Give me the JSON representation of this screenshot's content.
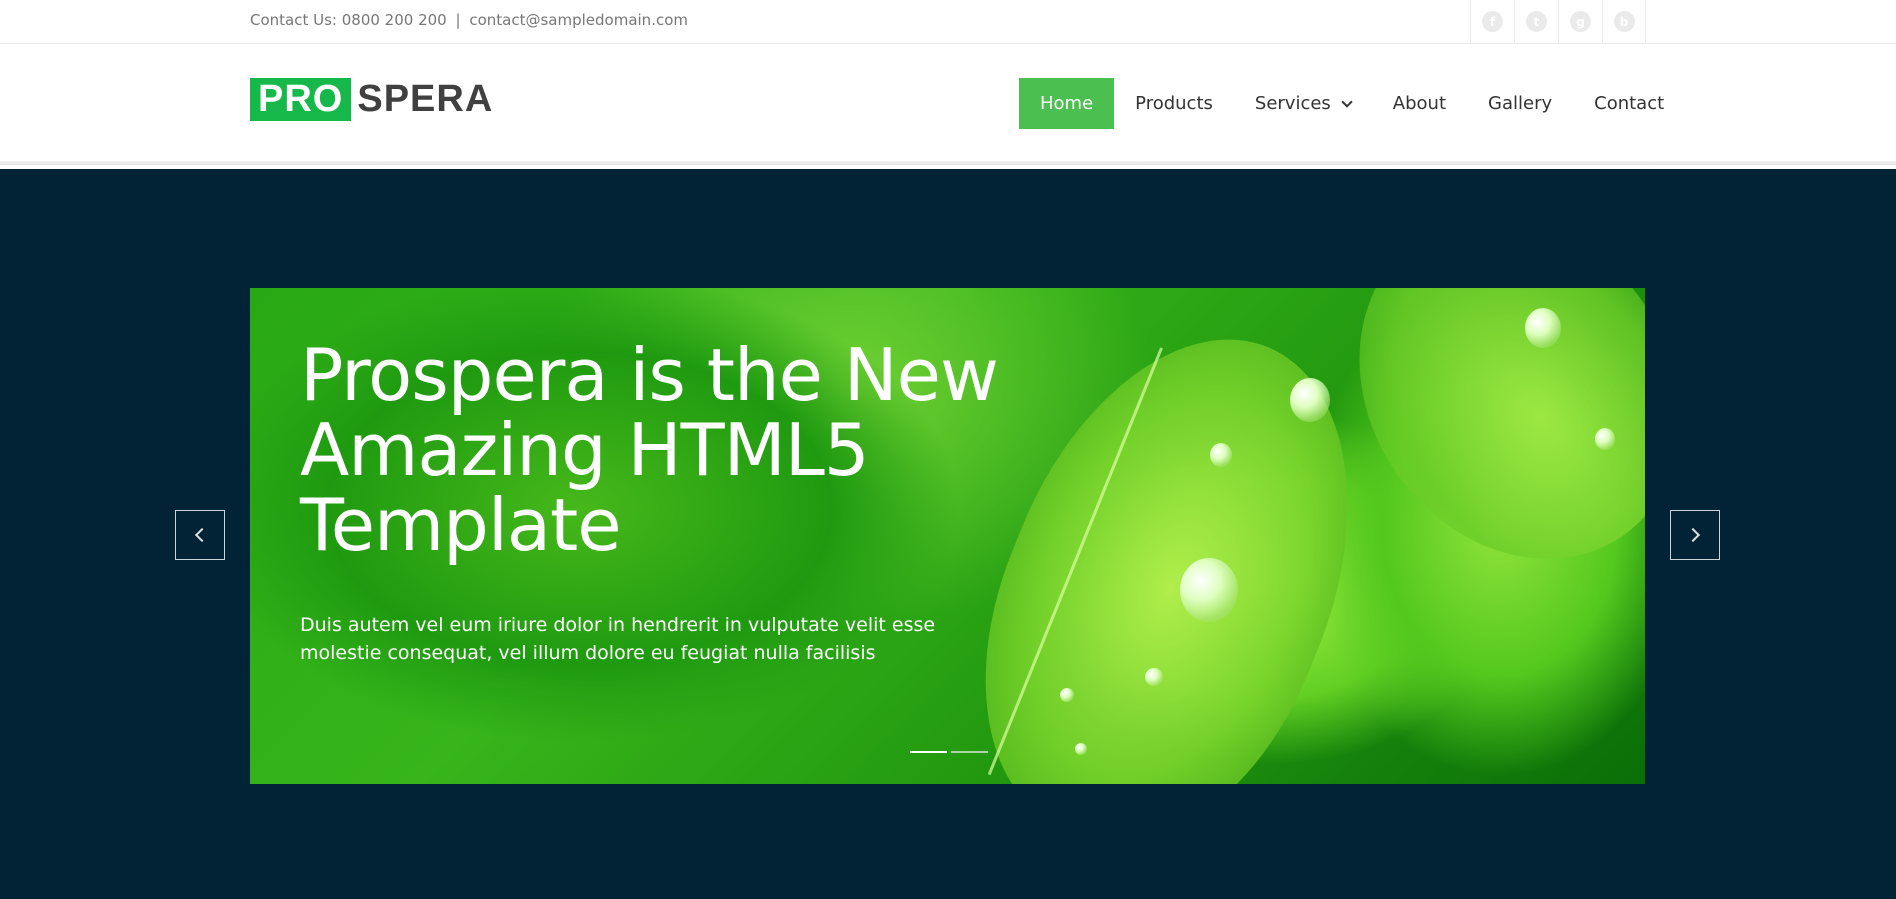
{
  "topbar": {
    "contact_label": "Contact Us: 0800 200 200",
    "separator": "|",
    "email": "contact@sampledomain.com",
    "social": [
      {
        "icon": "facebook-icon",
        "glyph": "f"
      },
      {
        "icon": "twitter-icon",
        "glyph": "t"
      },
      {
        "icon": "google-plus-icon",
        "glyph": "g"
      },
      {
        "icon": "rss-icon",
        "glyph": "b"
      }
    ]
  },
  "logo": {
    "part1": "PRO",
    "part2": "SPERA"
  },
  "nav": {
    "items": [
      {
        "label": "Home",
        "active": true
      },
      {
        "label": "Products"
      },
      {
        "label": "Services",
        "dropdown": true
      },
      {
        "label": "About"
      },
      {
        "label": "Gallery"
      },
      {
        "label": "Contact"
      }
    ]
  },
  "slider": {
    "title": "Prospera is the New Amazing HTML5 Template",
    "text": "Duis autem vel eum iriure dolor in hendrerit in vulputate velit esse molestie consequat, vel illum dolore eu feugiat nulla facilisis",
    "active_slide": 1,
    "slide_count": 2
  },
  "colors": {
    "brand_green": "#16b84a",
    "nav_active": "#4bbf4f",
    "hero_bg": "#012335"
  }
}
